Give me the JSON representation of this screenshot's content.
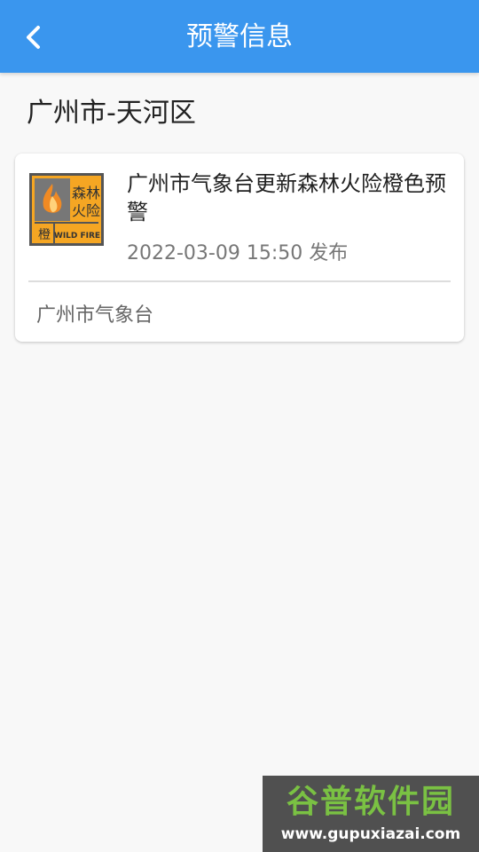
{
  "colors": {
    "header_bg": "#3a96ee",
    "page_bg": "#f8f8f8",
    "icon_orange": "#f5a623",
    "icon_gray": "#888888"
  },
  "header": {
    "back_icon": "chevron-left-icon",
    "title": "预警信息"
  },
  "location": "广州市-天河区",
  "alert": {
    "icon_name": "wildfire-orange-warning-icon",
    "icon_text_top": "森林",
    "icon_text_mid": "火险",
    "icon_level": "橙",
    "icon_en": "WILD FIRE",
    "headline": "广州市气象台更新森林火险橙色预警",
    "time": "2022-03-09 15:50 发布",
    "source": "广州市气象台"
  },
  "watermark": {
    "main": "谷普软件园",
    "url": "www.gupuxiazai.com"
  }
}
